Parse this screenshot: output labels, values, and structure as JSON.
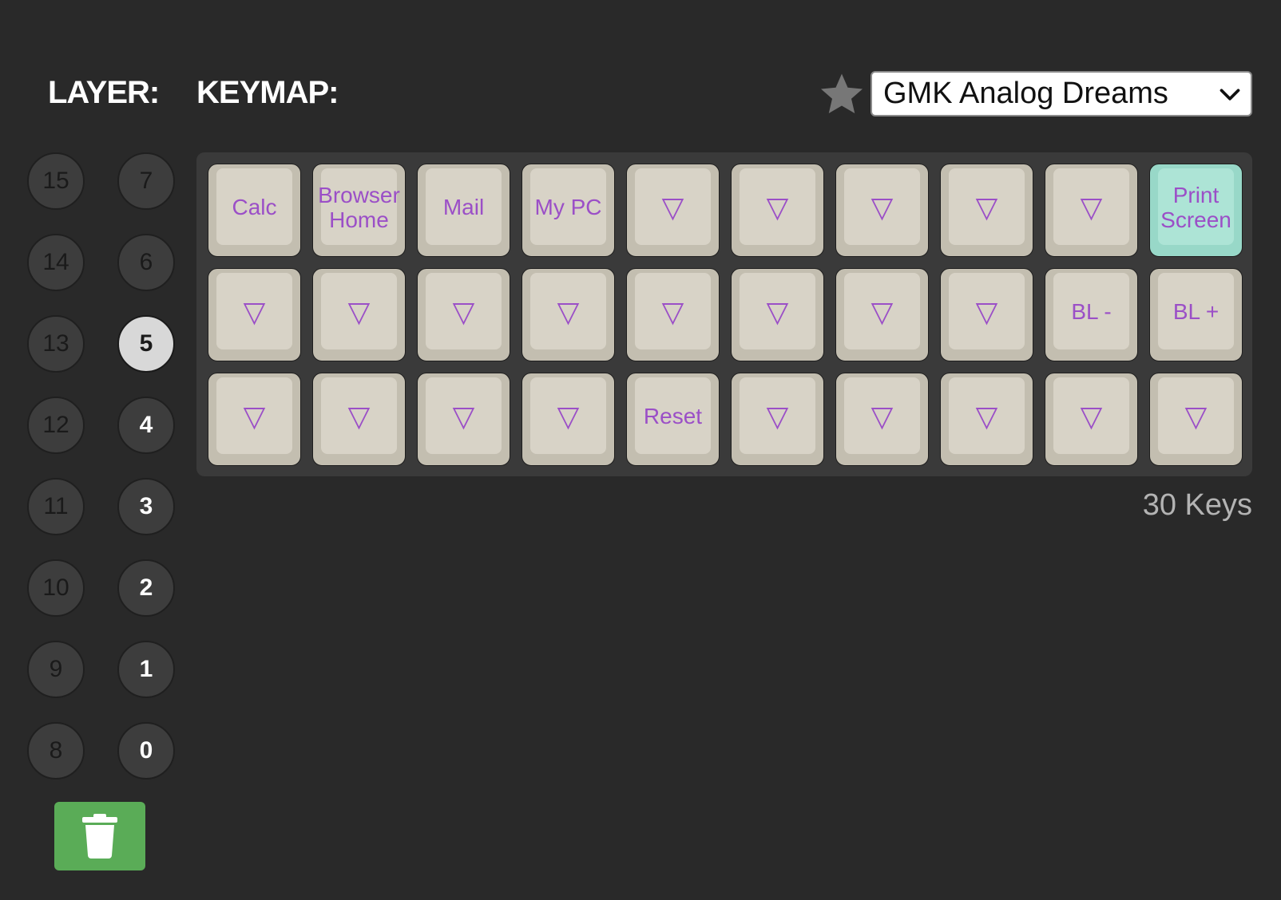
{
  "header": {
    "layer_label": "LAYER:",
    "keymap_label": "KEYMAP:",
    "keymap_select": {
      "selected": "GMK Analog Dreams",
      "favorite_icon": "star-icon",
      "star_color": "#777777"
    }
  },
  "layers": {
    "left_column": [
      "15",
      "14",
      "13",
      "12",
      "11",
      "10",
      "9",
      "8"
    ],
    "right_column": [
      "7",
      "6",
      "5",
      "4",
      "3",
      "2",
      "1",
      "0"
    ],
    "active": "5",
    "used": [
      "0",
      "1",
      "2",
      "3",
      "4",
      "5"
    ],
    "trash_icon": "trash-icon",
    "trash_color": "#5aac57"
  },
  "keyboard": {
    "rows": [
      [
        "Calc",
        "Browser\nHome",
        "Mail",
        "My PC",
        "▽",
        "▽",
        "▽",
        "▽",
        "▽",
        "Print\nScreen"
      ],
      [
        "▽",
        "▽",
        "▽",
        "▽",
        "▽",
        "▽",
        "▽",
        "▽",
        "BL -",
        "BL +"
      ],
      [
        "▽",
        "▽",
        "▽",
        "▽",
        "Reset",
        "▽",
        "▽",
        "▽",
        "▽",
        "▽"
      ]
    ],
    "accent_keys": [
      "Print\nScreen"
    ],
    "legend_color": "#9b4fc7",
    "keycap_color": "#d8d3c7",
    "accent_color": "#ade4d6",
    "key_count": "30 Keys"
  }
}
